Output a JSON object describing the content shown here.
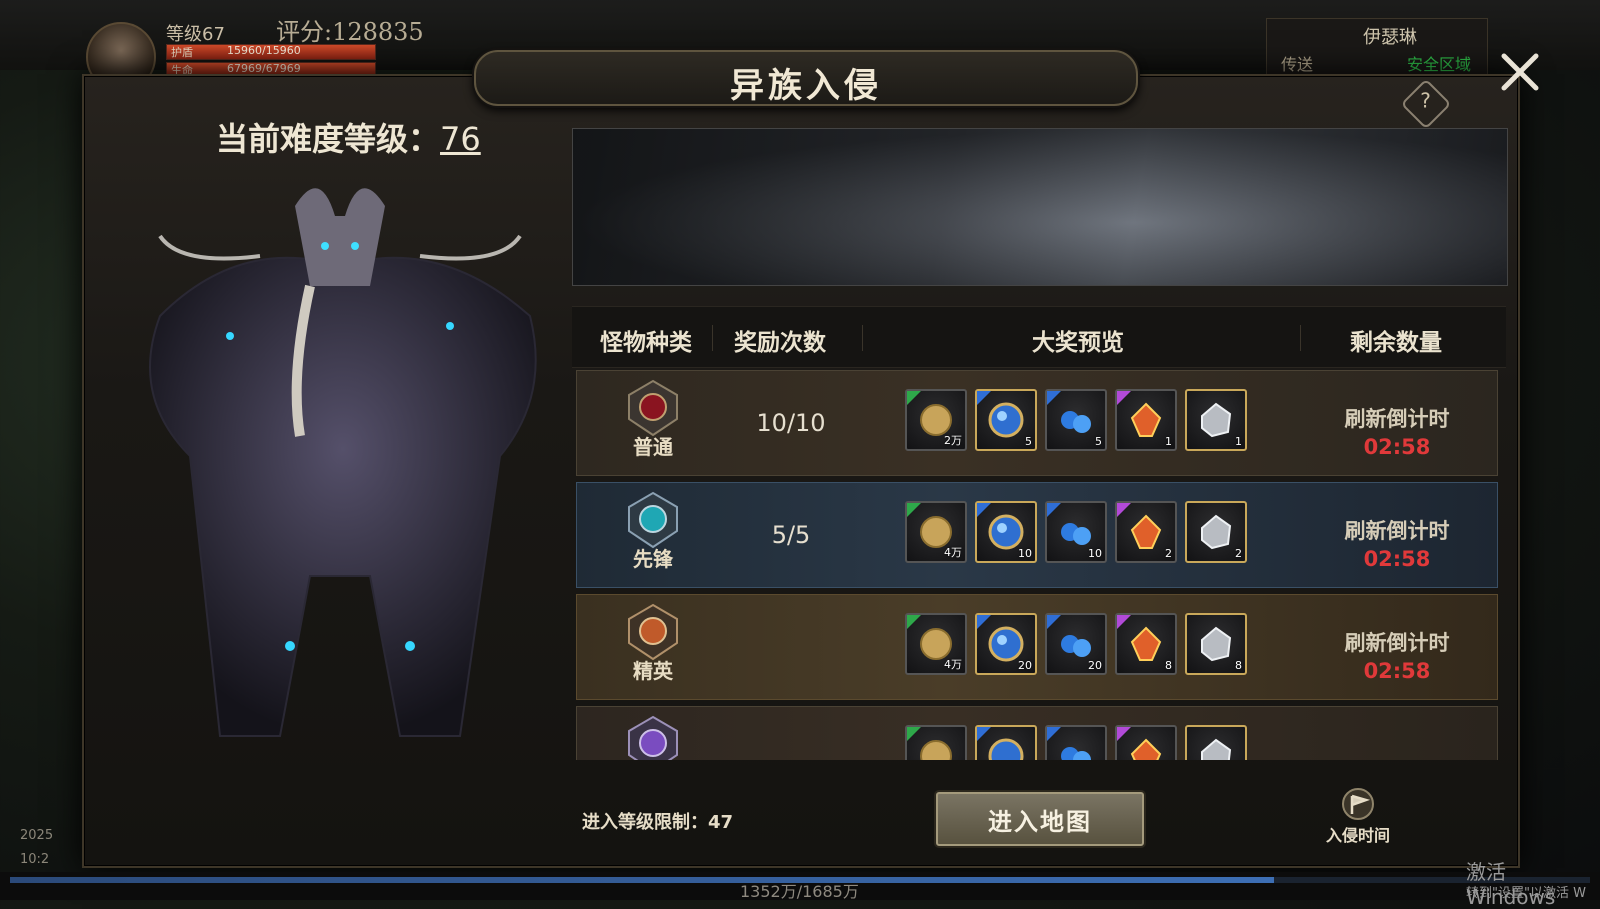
{
  "hud": {
    "level": "等级67",
    "score": "评分:128835",
    "shield_label": "护盾",
    "shield_value": "15960/15960",
    "hp_label": "生命",
    "hp_value": "67969/67969",
    "player_name": "伊瑟琳",
    "teleport": "传送",
    "safe_zone": "安全区域",
    "exp_text": "1352万/1685万",
    "exp_fraction": 0.8,
    "date": "2025",
    "time": "10:2",
    "windows_activate": "激活 Windows",
    "windows_activate_sub": "转到\"设置\"以激活 W"
  },
  "panel": {
    "title": "异族入侵",
    "difficulty_label": "当前难度等级：",
    "difficulty_value": "76",
    "help_icon": "question-icon",
    "close_icon": "close-icon"
  },
  "table": {
    "headers": {
      "monster_type": "怪物种类",
      "reward_count": "奖励次数",
      "prize_preview": "大奖预览",
      "remaining": "剩余数量"
    },
    "rows": [
      {
        "type": "普通",
        "count": "10/10",
        "refresh_label": "刷新倒计时",
        "refresh_time": "02:58",
        "items": [
          {
            "icon": "gold-coin-icon",
            "qty": "2万"
          },
          {
            "icon": "blue-orb-icon",
            "qty": "5"
          },
          {
            "icon": "blue-gems-icon",
            "qty": "5"
          },
          {
            "icon": "fire-crystal-icon",
            "qty": "1"
          },
          {
            "icon": "silver-ore-icon",
            "qty": "1"
          }
        ]
      },
      {
        "type": "先锋",
        "count": "5/5",
        "refresh_label": "刷新倒计时",
        "refresh_time": "02:58",
        "items": [
          {
            "icon": "gold-coin-icon",
            "qty": "4万"
          },
          {
            "icon": "blue-orb-icon",
            "qty": "10"
          },
          {
            "icon": "blue-gems-icon",
            "qty": "10"
          },
          {
            "icon": "fire-crystal-icon",
            "qty": "2"
          },
          {
            "icon": "silver-ore-icon",
            "qty": "2"
          }
        ]
      },
      {
        "type": "精英",
        "count": "",
        "refresh_label": "刷新倒计时",
        "refresh_time": "02:58",
        "items": [
          {
            "icon": "gold-coin-icon",
            "qty": "4万"
          },
          {
            "icon": "blue-orb-icon",
            "qty": "20"
          },
          {
            "icon": "blue-gems-icon",
            "qty": "20"
          },
          {
            "icon": "fire-crystal-icon",
            "qty": "8"
          },
          {
            "icon": "silver-ore-icon",
            "qty": "8"
          }
        ]
      },
      {
        "type": "",
        "count": "",
        "refresh_label": "",
        "refresh_time": "",
        "items": [
          {
            "icon": "gold-coin-icon",
            "qty": ""
          },
          {
            "icon": "blue-orb-icon",
            "qty": ""
          },
          {
            "icon": "blue-gems-icon",
            "qty": ""
          },
          {
            "icon": "fire-crystal-icon",
            "qty": ""
          },
          {
            "icon": "silver-ore-icon",
            "qty": ""
          }
        ]
      }
    ]
  },
  "footer": {
    "level_limit": "进入等级限制：47",
    "enter_button": "进入地图",
    "invade_time": "入侵时间"
  },
  "colors": {
    "countdown": "#e0393a",
    "accent_gold": "#c9a85a"
  }
}
